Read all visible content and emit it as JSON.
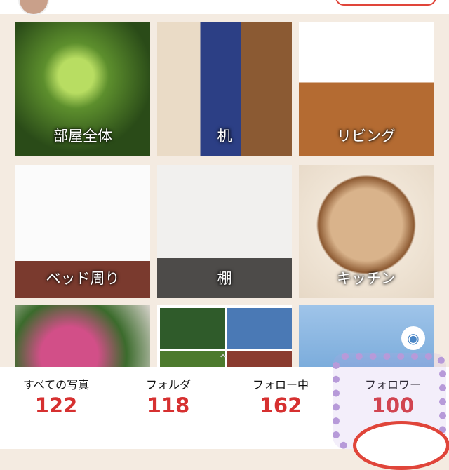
{
  "tiles": [
    {
      "label": "部屋全体"
    },
    {
      "label": "机"
    },
    {
      "label": "リビング"
    },
    {
      "label": "ベッド周り"
    },
    {
      "label": "棚"
    },
    {
      "label": "キッチン"
    }
  ],
  "stats": {
    "all_photos": {
      "label": "すべての写真",
      "count": "122"
    },
    "folders": {
      "label": "フォルダ",
      "count": "118"
    },
    "following": {
      "label": "フォロー中",
      "count": "162"
    },
    "followers": {
      "label": "フォロワー",
      "count": "100"
    }
  },
  "icons": {
    "camera": "camera-icon",
    "scroll_up": "chevron-up-icon"
  },
  "colors": {
    "accent": "#d63030",
    "background": "#f4ebe1",
    "highlight_frame": "#b79ad9"
  }
}
